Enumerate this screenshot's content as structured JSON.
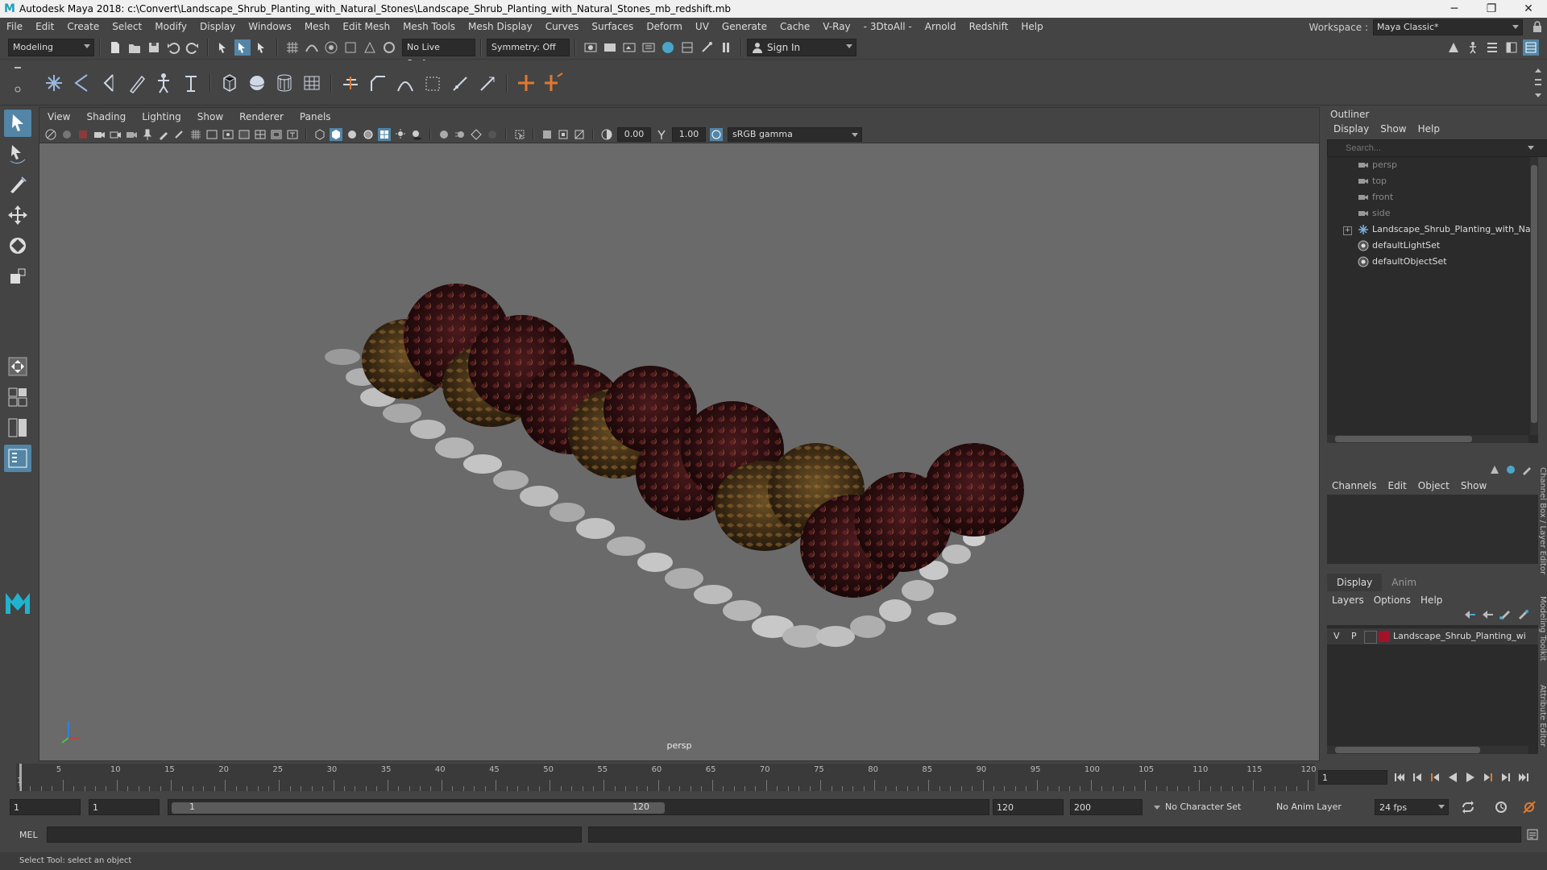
{
  "window": {
    "title": "Autodesk Maya 2018: c:\\Convert\\Landscape_Shrub_Planting_with_Natural_Stones\\Landscape_Shrub_Planting_with_Natural_Stones_mb_redshift.mb",
    "logo": "M",
    "minimize": "─",
    "maximize": "❐",
    "close": "✕"
  },
  "menubar": {
    "items": [
      "File",
      "Edit",
      "Create",
      "Select",
      "Modify",
      "Display",
      "Windows",
      "Mesh",
      "Edit Mesh",
      "Mesh Tools",
      "Mesh Display",
      "Curves",
      "Surfaces",
      "Deform",
      "UV",
      "Generate",
      "Cache",
      "V-Ray",
      "- 3DtoAll -",
      "Arnold",
      "Redshift",
      "Help"
    ],
    "workspace_label": "Workspace :",
    "workspace_value": "Maya Classic*"
  },
  "statusline": {
    "mode": "Modeling",
    "live_surface": "No Live Surface",
    "symmetry": "Symmetry: Off",
    "signin": "Sign In"
  },
  "viewport": {
    "menu": [
      "View",
      "Shading",
      "Lighting",
      "Show",
      "Renderer",
      "Panels"
    ],
    "exposure": "0.00",
    "gamma": "1.00",
    "color_space": "sRGB gamma",
    "camera_label": "persp"
  },
  "outliner": {
    "title": "Outliner",
    "menu": [
      "Display",
      "Show",
      "Help"
    ],
    "search_placeholder": "Search...",
    "items": [
      {
        "label": "persp",
        "icon": "camera-icon"
      },
      {
        "label": "top",
        "icon": "camera-icon"
      },
      {
        "label": "front",
        "icon": "camera-icon"
      },
      {
        "label": "side",
        "icon": "camera-icon"
      },
      {
        "label": "Landscape_Shrub_Planting_with_Natura",
        "icon": "group-icon"
      },
      {
        "label": "defaultLightSet",
        "icon": "set-icon"
      },
      {
        "label": "defaultObjectSet",
        "icon": "set-icon"
      }
    ]
  },
  "channelbox": {
    "menu": [
      "Channels",
      "Edit",
      "Object",
      "Show"
    ]
  },
  "layereditor": {
    "tabs": [
      "Display",
      "Anim"
    ],
    "menu": [
      "Layers",
      "Options",
      "Help"
    ],
    "layer": {
      "v": "V",
      "p": "P",
      "name": "Landscape_Shrub_Planting_wi",
      "color": "#a3122a"
    }
  },
  "side_tabs": [
    "Channel Box / Layer Editor",
    "Modeling Toolkit",
    "Attribute Editor"
  ],
  "timeline": {
    "ticks": [
      "5",
      "10",
      "15",
      "20",
      "25",
      "30",
      "35",
      "40",
      "45",
      "50",
      "55",
      "60",
      "65",
      "70",
      "75",
      "80",
      "85",
      "90",
      "95",
      "100",
      "105",
      "110",
      "115",
      "120"
    ],
    "start_marker": "1",
    "current_frame": "1"
  },
  "range": {
    "start": "1",
    "playback_start": "1",
    "slider_start": "1",
    "slider_end": "120",
    "playback_end": "120",
    "end": "200",
    "character_set": "No Character Set",
    "anim_layer": "No Anim Layer",
    "fps": "24 fps"
  },
  "cmdline": {
    "label": "MEL"
  },
  "helpline": {
    "text": "Select Tool: select an object"
  }
}
